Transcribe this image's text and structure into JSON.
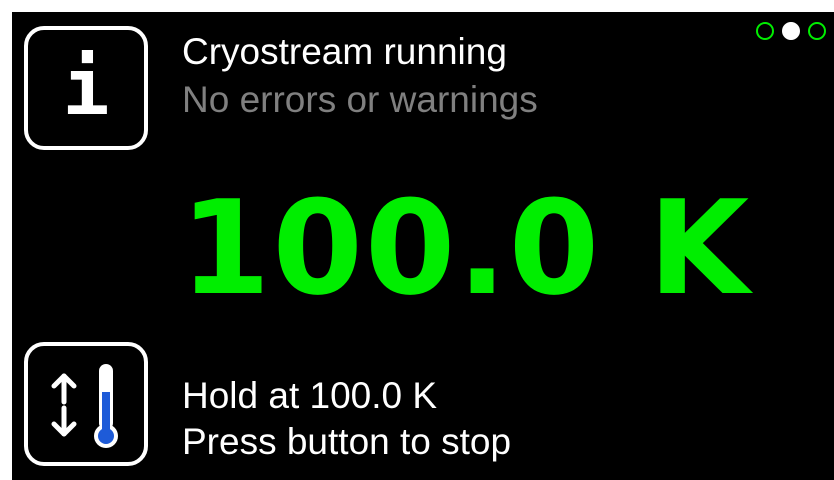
{
  "status": {
    "title": "Cryostream running",
    "subtitle": "No errors or warnings"
  },
  "temperature": {
    "value": "100.0 K"
  },
  "mode": {
    "line1": "Hold at 100.0 K",
    "line2": "Press button to stop"
  },
  "icons": {
    "info": "info-icon",
    "mode": "ramp-hold-thermometer-icon",
    "info_glyph": "i"
  },
  "pager": {
    "pages": 3,
    "active_page": 2
  },
  "colors": {
    "background": "#000000",
    "primary_text": "#ffffff",
    "secondary_text": "#808080",
    "temperature": "#00ee00",
    "thermometer_fill": "#1e5bd8",
    "dot_inactive": "#00ee00",
    "dot_active": "#ffffff"
  }
}
